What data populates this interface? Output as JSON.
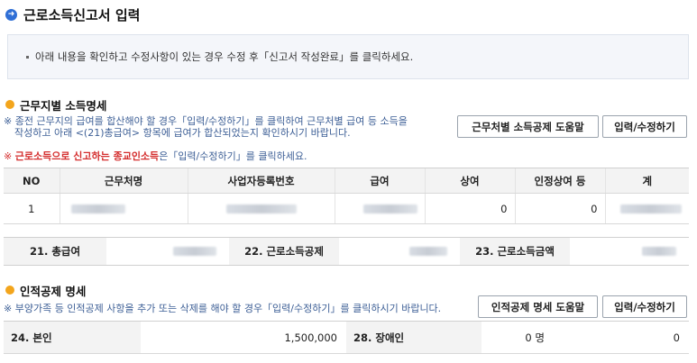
{
  "page": {
    "title": "근로소득신고서 입력"
  },
  "notice": {
    "text": "아래 내용을 확인하고 수정사항이 있는 경우 수정 후「신고서 작성완료」를 클릭하세요."
  },
  "section1": {
    "title": "근무지별 소득명세",
    "desc_line1": "※ 종전 근무지의 급여를 합산해야 할 경우「입력/수정하기」를 클릭하여 근무처별 급여 등 소득을",
    "desc_line2": "작성하고 아래 <(21)총급여> 항목에 급여가 합산되었는지 확인하시기 바랍니다.",
    "red_prefix": "※ ",
    "red_text": "근로소득으로 신고하는 종교인소득",
    "red_suffix": "은「입력/수정하기」를 클릭하세요.",
    "help_button": "근무처별 소득공제 도움말",
    "edit_button": "입력/수정하기"
  },
  "income_table": {
    "headers": [
      "NO",
      "근무처명",
      "사업자등록번호",
      "급여",
      "상여",
      "인정상여 등",
      "계"
    ],
    "rows": [
      {
        "no": "1",
        "workplace": "",
        "bizno": "",
        "salary": "",
        "bonus": "0",
        "recognized_bonus": "0",
        "total": ""
      }
    ]
  },
  "totals": {
    "gross_label": "21. 총급여",
    "deduction_label": "22. 근로소득공제",
    "income_label": "23. 근로소득금액"
  },
  "section2": {
    "title": "인적공제 명세",
    "desc": "※ 부양가족 등 인적공제 사항을 추가 또는 삭제를 해야 할 경우「입력/수정하기」를 클릭하시기 바랍니다.",
    "help_button": "인적공제 명세 도움말",
    "edit_button": "입력/수정하기"
  },
  "personal_deduction": {
    "self_label": "24. 본인",
    "self_value": "1,500,000",
    "disabled_label": "28. 장애인",
    "disabled_count": "0",
    "disabled_unit": "명",
    "disabled_amount": "0"
  },
  "colors": {
    "accent_blue": "#2f6fd6",
    "section_orange": "#f3a51c",
    "desc_blue": "#3d5f96",
    "warning_red": "#d42d2d"
  }
}
